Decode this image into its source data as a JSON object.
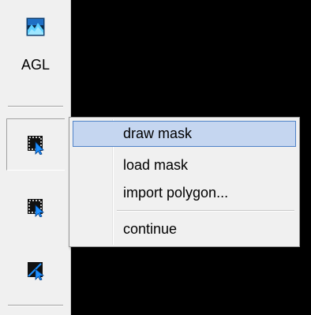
{
  "toolbar": {
    "agl_label": "AGL",
    "buttons": [
      {
        "icon": "terrain-icon"
      },
      {
        "icon": "select-mask-cursor-icon"
      },
      {
        "icon": "select-area-icon"
      },
      {
        "icon": "draw-line-cursor-icon"
      }
    ]
  },
  "context_menu": {
    "items": [
      {
        "label": "draw mask",
        "highlighted": true
      },
      {
        "label": "load mask"
      },
      {
        "label": "import polygon..."
      },
      {
        "label": "continue"
      }
    ]
  },
  "colors": {
    "canvas": "#000000",
    "toolbar": "#f0f0f0",
    "menu_highlight": "#c5d6f0",
    "menu_highlight_border": "#4f82c8",
    "icon_blue": "#1e90ff"
  }
}
